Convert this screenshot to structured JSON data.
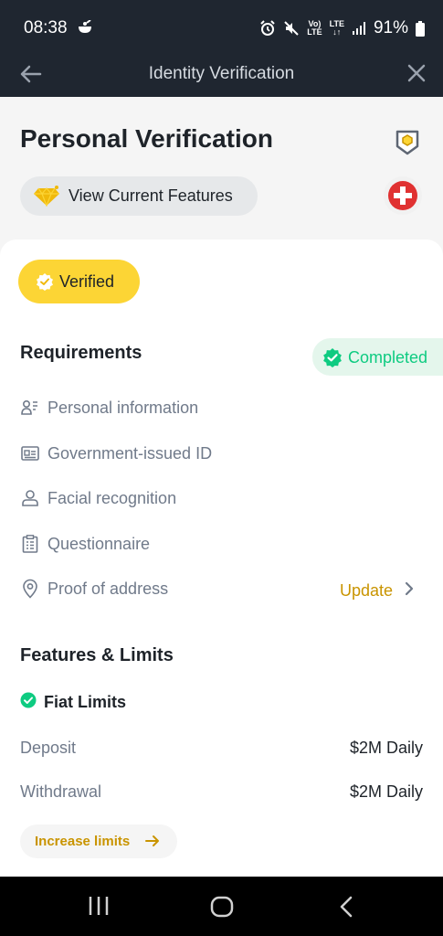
{
  "status_bar": {
    "time": "08:38",
    "battery": "91%",
    "volte": "Vo)",
    "lte_top": "LTE",
    "lte_bottom": "LTE"
  },
  "app_bar": {
    "title": "Identity Verification"
  },
  "header": {
    "title": "Personal Verification",
    "features_label": "View Current Features"
  },
  "status": {
    "verified_label": "Verified"
  },
  "requirements": {
    "title": "Requirements",
    "completed_label": "Completed",
    "items": [
      {
        "icon": "person-info-icon",
        "label": "Personal information"
      },
      {
        "icon": "id-card-icon",
        "label": "Government-issued ID"
      },
      {
        "icon": "person-icon",
        "label": "Facial recognition"
      },
      {
        "icon": "clipboard-icon",
        "label": "Questionnaire"
      },
      {
        "icon": "location-pin-icon",
        "label": "Proof of address"
      }
    ],
    "update_label": "Update"
  },
  "features": {
    "title": "Features & Limits",
    "fiat_label": "Fiat Limits",
    "rows": [
      {
        "label": "Deposit",
        "value": "$2M Daily"
      },
      {
        "label": "Withdrawal",
        "value": "$2M Daily"
      }
    ],
    "increase_label": "Increase limits"
  },
  "colors": {
    "brand_yellow": "#fcd535",
    "success_green": "#0ecb81",
    "link_gold": "#c99400",
    "dark_bar": "#1f2630"
  }
}
